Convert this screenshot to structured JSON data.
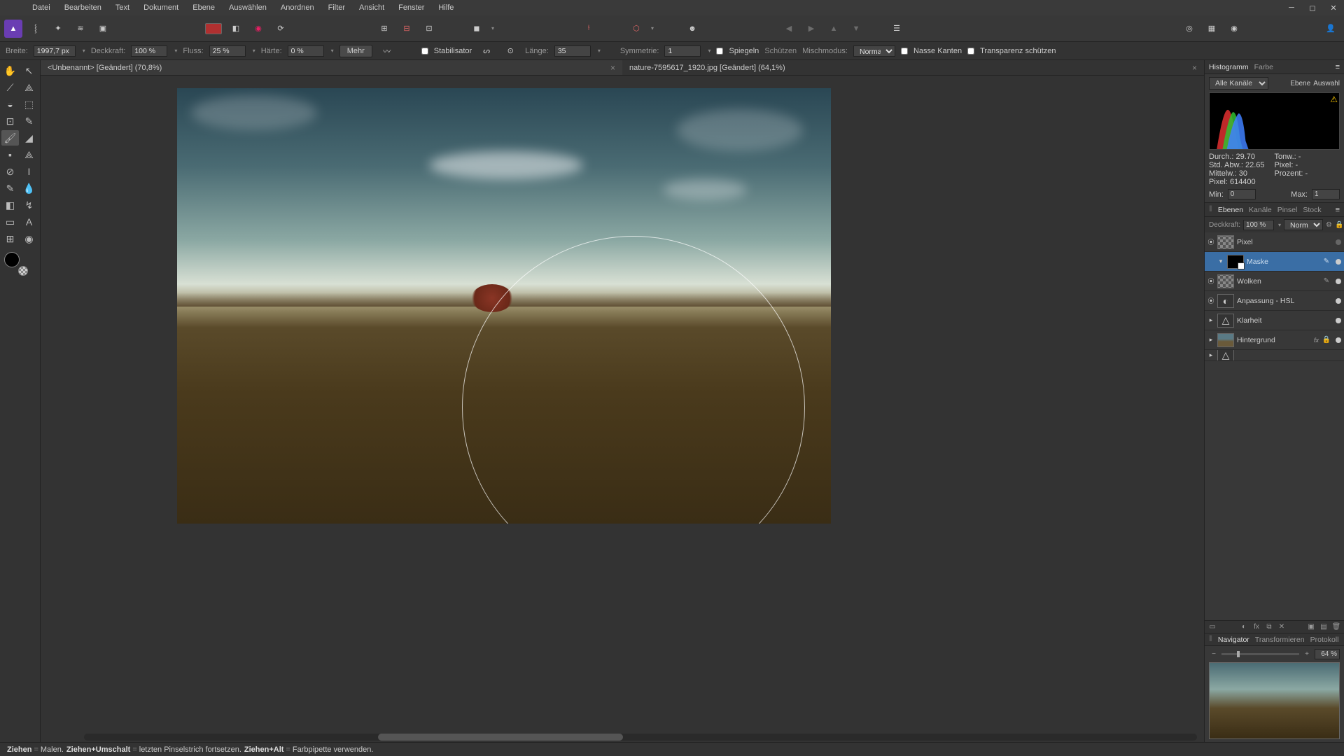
{
  "menus": [
    "Datei",
    "Bearbeiten",
    "Text",
    "Dokument",
    "Ebene",
    "Auswählen",
    "Anordnen",
    "Filter",
    "Ansicht",
    "Fenster",
    "Hilfe"
  ],
  "ctx": {
    "width_label": "Breite:",
    "width_value": "1997,7 px",
    "opacity_label": "Deckkraft:",
    "opacity_value": "100 %",
    "flow_label": "Fluss:",
    "flow_value": "25 %",
    "hardness_label": "Härte:",
    "hardness_value": "0 %",
    "more": "Mehr",
    "stabilizer": "Stabilisator",
    "length_label": "Länge:",
    "length_value": "35",
    "symmetry_label": "Symmetrie:",
    "symmetry_value": "1",
    "mirror": "Spiegeln",
    "protect": "Schützen",
    "blend_label": "Mischmodus:",
    "blend_value": "Normal",
    "wet_edges": "Nasse Kanten",
    "protect_alpha": "Transparenz schützen"
  },
  "tabs": [
    {
      "title": "<Unbenannt> [Geändert] (70,8%)",
      "active": true,
      "pos": "left"
    },
    {
      "title": "nature-7595617_1920.jpg [Geändert] (64,1%)",
      "active": false,
      "pos": "right"
    }
  ],
  "histo": {
    "tab1": "Histogramm",
    "tab2": "Farbe",
    "channels": "Alle Kanäle",
    "btn_layer": "Ebene",
    "btn_sel": "Auswahl",
    "stats": {
      "durch": "Durch.: 29.70",
      "tonw": "Tonw.: -",
      "std": "Std. Abw.: 22.65",
      "pixel_r": "Pixel: -",
      "mittel": "Mittelw.: 30",
      "prozent": "Prozent: -",
      "pixel": "Pixel: 614400"
    },
    "min_label": "Min:",
    "min_val": "0",
    "max_label": "Max:",
    "max_val": "1"
  },
  "layers": {
    "tabs": [
      "Ebenen",
      "Kanäle",
      "Pinsel",
      "Stock"
    ],
    "opacity_label": "Deckkraft:",
    "opacity_val": "100 %",
    "blend": "Normal",
    "items": [
      {
        "name": "Pixel",
        "thumb": "checker",
        "visible": false,
        "indent": false
      },
      {
        "name": "Maske",
        "thumb": "mask",
        "visible": true,
        "selected": true,
        "indent": true,
        "collapse": true
      },
      {
        "name": "Wolken",
        "thumb": "checker",
        "visible": true,
        "indent": false,
        "editable": true
      },
      {
        "name": "Anpassung - HSL",
        "thumb": "adjust",
        "visible": true,
        "indent": false,
        "icon": "◐"
      },
      {
        "name": "Klarheit",
        "thumb": "adjust",
        "visible": true,
        "indent": false,
        "icon": "△",
        "collapse": true
      },
      {
        "name": "Hintergrund",
        "thumb": "landscape",
        "visible": true,
        "indent": false,
        "fx": "fx",
        "lock": true,
        "collapse": true
      }
    ]
  },
  "nav": {
    "tabs": [
      "Navigator",
      "Transformieren",
      "Protokoll"
    ],
    "zoom": "64 %"
  },
  "status": {
    "k1": "Ziehen",
    "v1": "Malen.",
    "k2": "Ziehen+Umschalt",
    "v2": "letzten Pinselstrich fortsetzen.",
    "k3": "Ziehen+Alt",
    "v3": "Farbpipette verwenden."
  }
}
